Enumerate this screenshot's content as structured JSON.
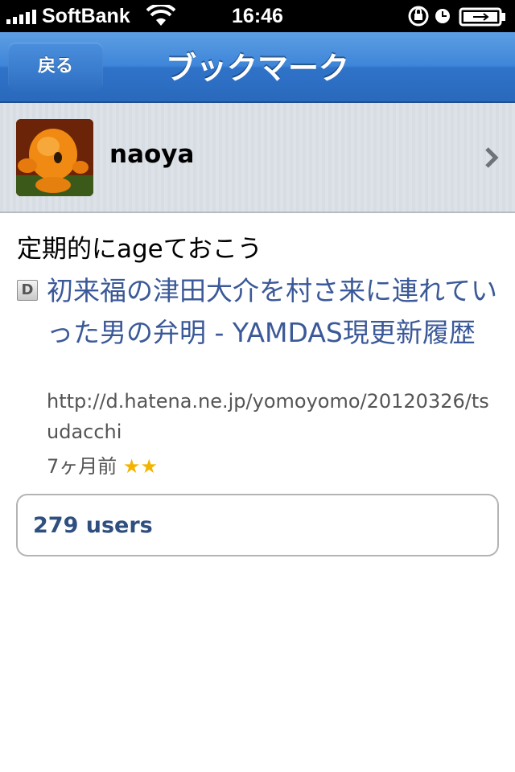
{
  "status_bar": {
    "carrier": "SoftBank",
    "time": "16:46"
  },
  "nav": {
    "back_label": "戻る",
    "title": "ブックマーク"
  },
  "user": {
    "name": "naoya"
  },
  "bookmark": {
    "comment": "定期的にageておこう",
    "entry_icon": "D",
    "entry_title": "初来福の津田大介を村さ来に連れていった男の弁明 - YAMDAS現更新履歴",
    "entry_url": "http://d.hatena.ne.jp/yomoyomo/20120326/tsudacchi",
    "age": "7ヶ月前",
    "stars": "★★"
  },
  "users_button": {
    "label": "279 users"
  },
  "colors": {
    "nav_blue": "#3f86d9",
    "link_blue": "#3b5998",
    "star_yellow": "#f3b400"
  }
}
